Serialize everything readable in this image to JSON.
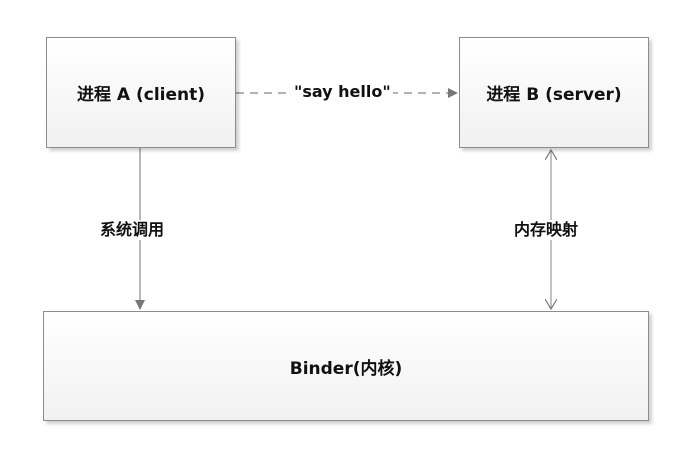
{
  "diagram": {
    "nodes": {
      "process_a": "进程 A (client)",
      "process_b": "进程 B (server)",
      "binder": "Binder(内核)"
    },
    "edges": {
      "say_hello": "\"say hello\"",
      "system_call": "系统调用",
      "memory_mapping": "内存映射"
    },
    "colors": {
      "stroke": "#8c8c8c",
      "text": "#111111",
      "box_fill": "#f1f1f1"
    }
  }
}
